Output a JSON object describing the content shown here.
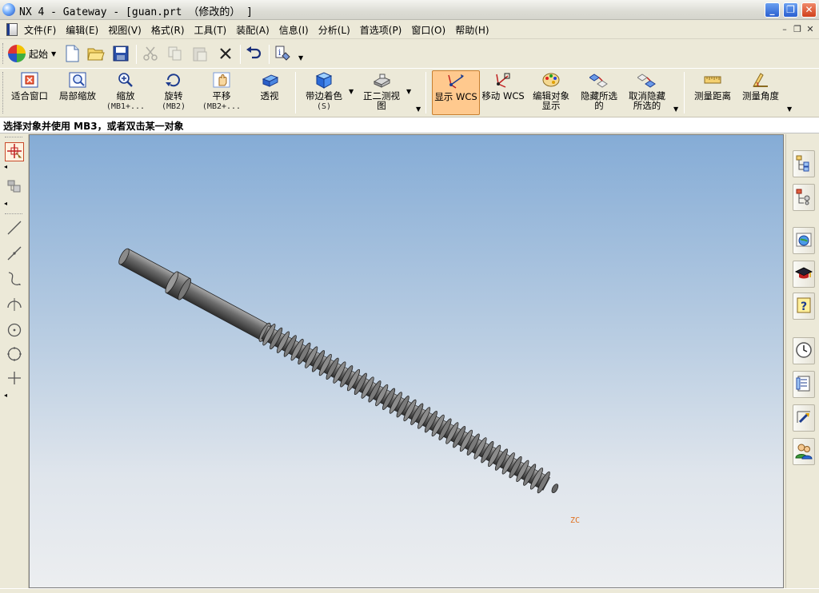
{
  "window": {
    "title": "NX 4 - Gateway - [guan.prt （修改的） ]",
    "minimize_label": "_",
    "restore_label": "❐",
    "close_label": "✕"
  },
  "menubar": {
    "items": [
      "文件(F)",
      "编辑(E)",
      "视图(V)",
      "格式(R)",
      "工具(T)",
      "装配(A)",
      "信息(I)",
      "分析(L)",
      "首选项(P)",
      "窗口(O)",
      "帮助(H)"
    ],
    "mdi_minimize": "–",
    "mdi_restore": "❐",
    "mdi_close": "✕"
  },
  "standard_toolbar": {
    "start_label": "起始",
    "icons": [
      "new-icon",
      "open-icon",
      "save-icon",
      "cut-icon",
      "copy-icon",
      "paste-icon",
      "delete-icon",
      "undo-icon",
      "info-icon"
    ]
  },
  "view_toolbar": {
    "buttons": [
      {
        "name": "fit",
        "label": "适合窗口",
        "sub": ""
      },
      {
        "name": "zoom-region",
        "label": "局部缩放",
        "sub": ""
      },
      {
        "name": "zoom",
        "label": "缩放",
        "sub": "(MB1+..."
      },
      {
        "name": "rotate",
        "label": "旋转",
        "sub": "(MB2)"
      },
      {
        "name": "pan",
        "label": "平移",
        "sub": "(MB2+..."
      },
      {
        "name": "perspective",
        "label": "透视",
        "sub": ""
      },
      {
        "name": "shaded-edges",
        "label": "带边着色",
        "sub": "(S)"
      },
      {
        "name": "trimetric",
        "label": "正二测视",
        "sub": "图"
      },
      {
        "name": "show-wcs",
        "label": "显示 WCS",
        "sub": ""
      },
      {
        "name": "move-wcs",
        "label": "移动 WCS",
        "sub": ""
      },
      {
        "name": "edit-display",
        "label": "编辑对象",
        "sub": "显示"
      },
      {
        "name": "hide-selected",
        "label": "隐藏所选",
        "sub": "的"
      },
      {
        "name": "unhide-selected",
        "label": "取消隐藏",
        "sub": "所选的"
      },
      {
        "name": "measure-distance",
        "label": "测量距离",
        "sub": ""
      },
      {
        "name": "measure-angle",
        "label": "测量角度",
        "sub": ""
      }
    ]
  },
  "prompt": {
    "text": "选择对象并使用 MB3，或者双击某一对象"
  },
  "viewport": {
    "wcs_label": "ZC",
    "background_top": "#85acd6",
    "background_bottom": "#eceef0",
    "model": "threaded-shaft"
  },
  "colors": {
    "active_button": "#ffc98e",
    "wcs_label": "#e07020",
    "titlebar_close": "#d0401c"
  }
}
